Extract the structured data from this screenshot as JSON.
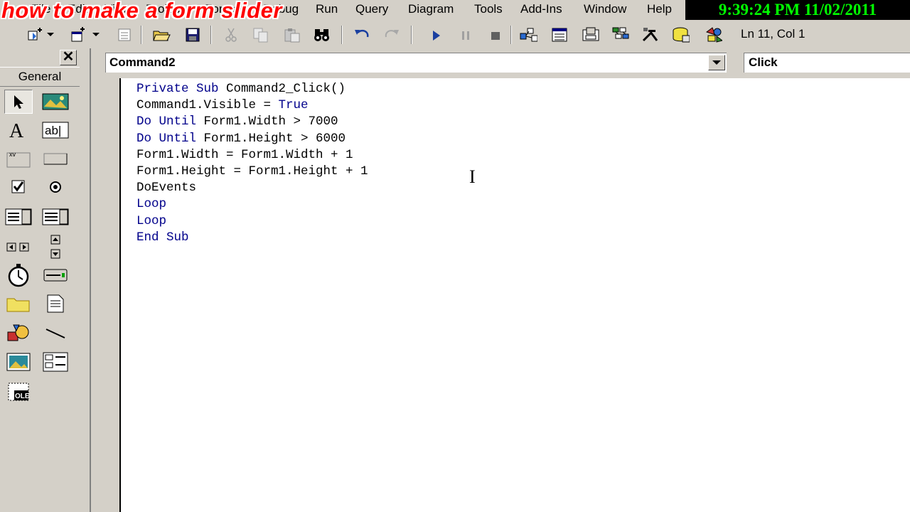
{
  "overlay_title": "how to make a form slider",
  "clock": "9:39:24 PM 11/02/2011",
  "menu": [
    "File",
    "Edit",
    "View",
    "Project",
    "Format",
    "Debug",
    "Run",
    "Query",
    "Diagram",
    "Tools",
    "Add-Ins",
    "Window",
    "Help"
  ],
  "status": {
    "position": "Ln 11, Col 1"
  },
  "toolbox": {
    "tab_label": "General",
    "close_label": "✕"
  },
  "code_window": {
    "object": "Command2",
    "procedure": "Click"
  },
  "code_lines": [
    [
      [
        "kw",
        "Private Sub "
      ],
      [
        "tx",
        "Command2_Click()"
      ]
    ],
    [
      [
        "tx",
        "Command1.Visible = "
      ],
      [
        "kw",
        "True"
      ]
    ],
    [
      [
        "kw",
        "Do Until "
      ],
      [
        "tx",
        "Form1.Width > 7000"
      ]
    ],
    [
      [
        "kw",
        "Do Until "
      ],
      [
        "tx",
        "Form1.Height > 6000"
      ]
    ],
    [
      [
        "tx",
        "Form1.Width = Form1.Width + 1"
      ]
    ],
    [
      [
        "tx",
        "Form1.Height = Form1.Height + 1"
      ]
    ],
    [
      [
        "tx",
        "DoEvents"
      ]
    ],
    [
      [
        "kw",
        "Loop"
      ]
    ],
    [
      [
        "kw",
        "Loop"
      ]
    ],
    [
      [
        "kw",
        "End Sub"
      ]
    ]
  ]
}
